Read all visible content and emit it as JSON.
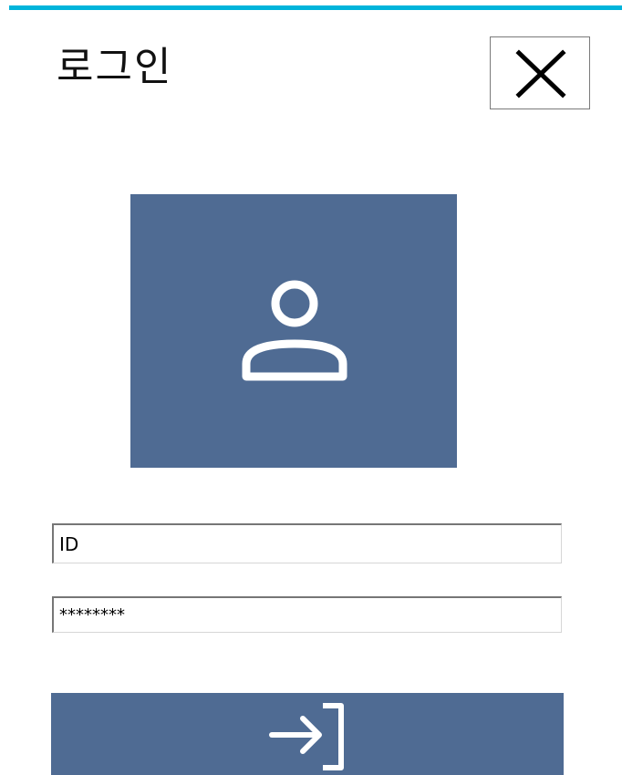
{
  "title": "로그인",
  "colors": {
    "accent": "#00b4db",
    "tile": "#4f6b93",
    "icon_on_tile": "#ffffff",
    "text": "#111111"
  },
  "icons": {
    "close": "close-icon",
    "avatar": "user-icon",
    "login": "sign-in-icon"
  },
  "form": {
    "id_value": "ID",
    "password_value": "********"
  }
}
